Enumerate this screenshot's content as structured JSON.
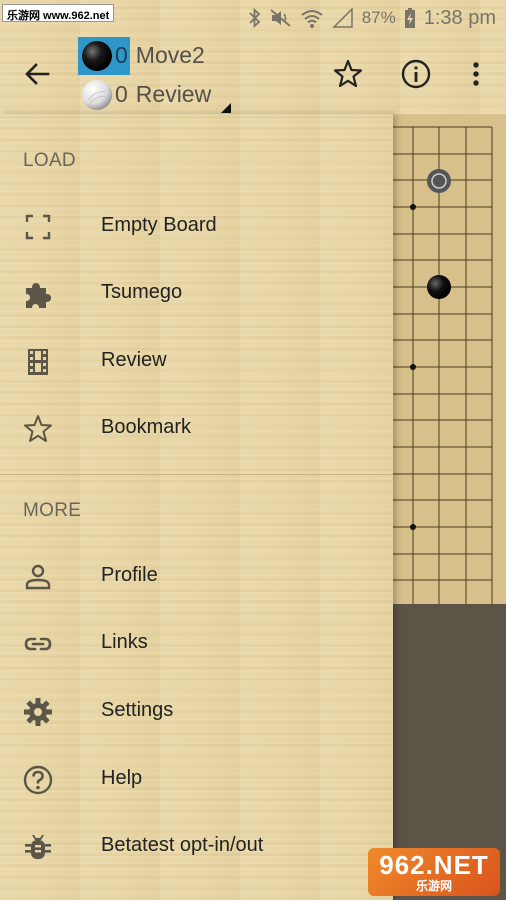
{
  "status_bar": {
    "watermark": "乐游网 www.962.net",
    "battery": "87%",
    "time": "1:38 pm"
  },
  "header": {
    "black_player": {
      "captures": "0",
      "name": "Move2"
    },
    "white_player": {
      "captures": "0",
      "name": "Review"
    },
    "icons": [
      "back-arrow-icon",
      "star-outline-icon",
      "info-icon",
      "more-vert-icon"
    ]
  },
  "drawer": {
    "load_section": {
      "title": "LOAD",
      "items": [
        {
          "label": "Empty Board",
          "icon": "fullscreen-corners-icon"
        },
        {
          "label": "Tsumego",
          "icon": "puzzle-icon"
        },
        {
          "label": "Review",
          "icon": "film-icon"
        },
        {
          "label": "Bookmark",
          "icon": "star-outline-icon"
        }
      ]
    },
    "more_section": {
      "title": "MORE",
      "items": [
        {
          "label": "Profile",
          "icon": "person-icon"
        },
        {
          "label": "Links",
          "icon": "link-icon"
        },
        {
          "label": "Settings",
          "icon": "gear-icon"
        },
        {
          "label": "Help",
          "icon": "help-circle-icon"
        },
        {
          "label": "Betatest opt-in/out",
          "icon": "bug-icon"
        }
      ]
    }
  },
  "watermark_bottom": {
    "big": "962.NET",
    "small": "乐游网"
  },
  "colors": {
    "active_player_bg": "#2f97c7",
    "wood": "#e8d6a6",
    "board_dark": "#5d5448",
    "icon": "#5c5648"
  }
}
